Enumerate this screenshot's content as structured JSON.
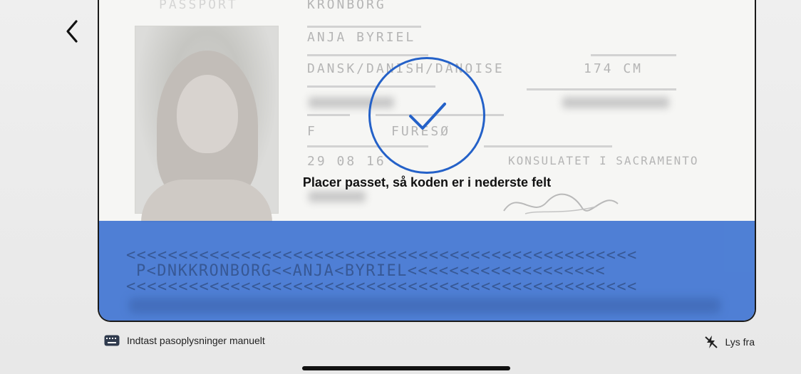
{
  "passport": {
    "header_left": "PASSPORT",
    "surname": "KRONBORG",
    "given_names": "ANJA BYRIEL",
    "nationality": "DANSK/DANISH/DANOISE",
    "height": "174 CM",
    "sex": "F",
    "place_of_birth": "FURESØ",
    "date_of_issue": "29 08 16",
    "authority": "KONSULATET I SACRAMENTO"
  },
  "scanner": {
    "instruction": "Placer passet, så koden er i nederste felt",
    "status": "success"
  },
  "mrz": {
    "line1": "<<<<<<<<<<<<<<<<<<<<<<<<<<<<<<<<<<<<<<<<<<<<<<<<<",
    "line2": "P<DNKKRONBORG<<ANJA<BYRIEL<<<<<<<<<<<<<<<<<<<",
    "line3": "<<<<<<<<<<<<<<<<<<<<<<<<<<<<<<<<<<<<<<<<<<<<<<<<<"
  },
  "footer": {
    "manual_label": "Indtast pasoplysninger manuelt",
    "flash_label": "Lys fra"
  },
  "icons": {
    "back": "chevron-left-icon",
    "keyboard": "keyboard-icon",
    "flash_off": "flash-off-icon",
    "check": "checkmark-icon"
  },
  "colors": {
    "accent": "#2461c8",
    "mrz_zone": "#3d73d2"
  }
}
